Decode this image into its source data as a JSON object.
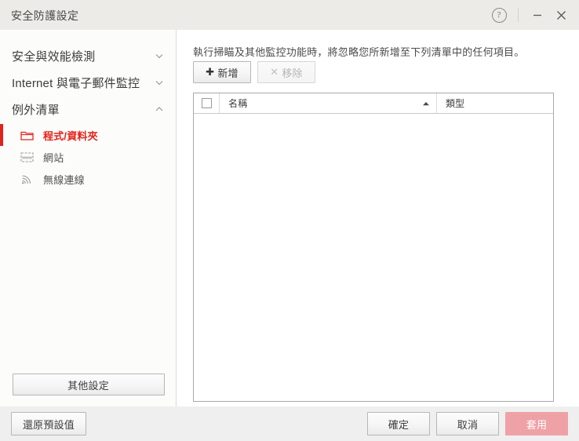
{
  "window": {
    "title": "安全防護設定",
    "help_label": "?",
    "minimize_label": "−",
    "close_label": "×",
    "accent_color": "#E32219",
    "titlebar_color": "#ECEBE7"
  },
  "sidebar": {
    "groups": [
      {
        "label": "安全與效能檢測",
        "chevron": "chevron-down",
        "expanded": false,
        "items": []
      },
      {
        "label": "Internet 與電子郵件監控",
        "chevron": "chevron-down",
        "expanded": false,
        "items": []
      },
      {
        "label": "例外清單",
        "chevron": "chevron-up",
        "expanded": true,
        "items": [
          {
            "label": "程式/資料夾",
            "icon": "folder-icon",
            "selected": true
          },
          {
            "label": "網站",
            "icon": "www-icon",
            "selected": false
          },
          {
            "label": "無線連線",
            "icon": "wifi-icon",
            "selected": false
          }
        ]
      }
    ],
    "other_settings_label": "其他設定"
  },
  "main": {
    "description": "執行掃瞄及其他監控功能時，將忽略您所新增至下列清單中的任何項目。",
    "toolbar": {
      "add_glyph": "✚",
      "add_label": "新增",
      "remove_glyph": "✕",
      "remove_label": "移除",
      "remove_disabled": true
    },
    "table": {
      "select_all_checked": false,
      "columns": [
        {
          "key": "name",
          "label": "名稱",
          "sort": "ascending"
        },
        {
          "key": "type",
          "label": "類型",
          "sort": "none"
        }
      ],
      "rows": []
    }
  },
  "footer": {
    "restore_defaults_label": "還原預設值",
    "ok_label": "確定",
    "cancel_label": "取消",
    "apply_label": "套用",
    "apply_disabled": true,
    "apply_color": "#EFA2A6"
  }
}
